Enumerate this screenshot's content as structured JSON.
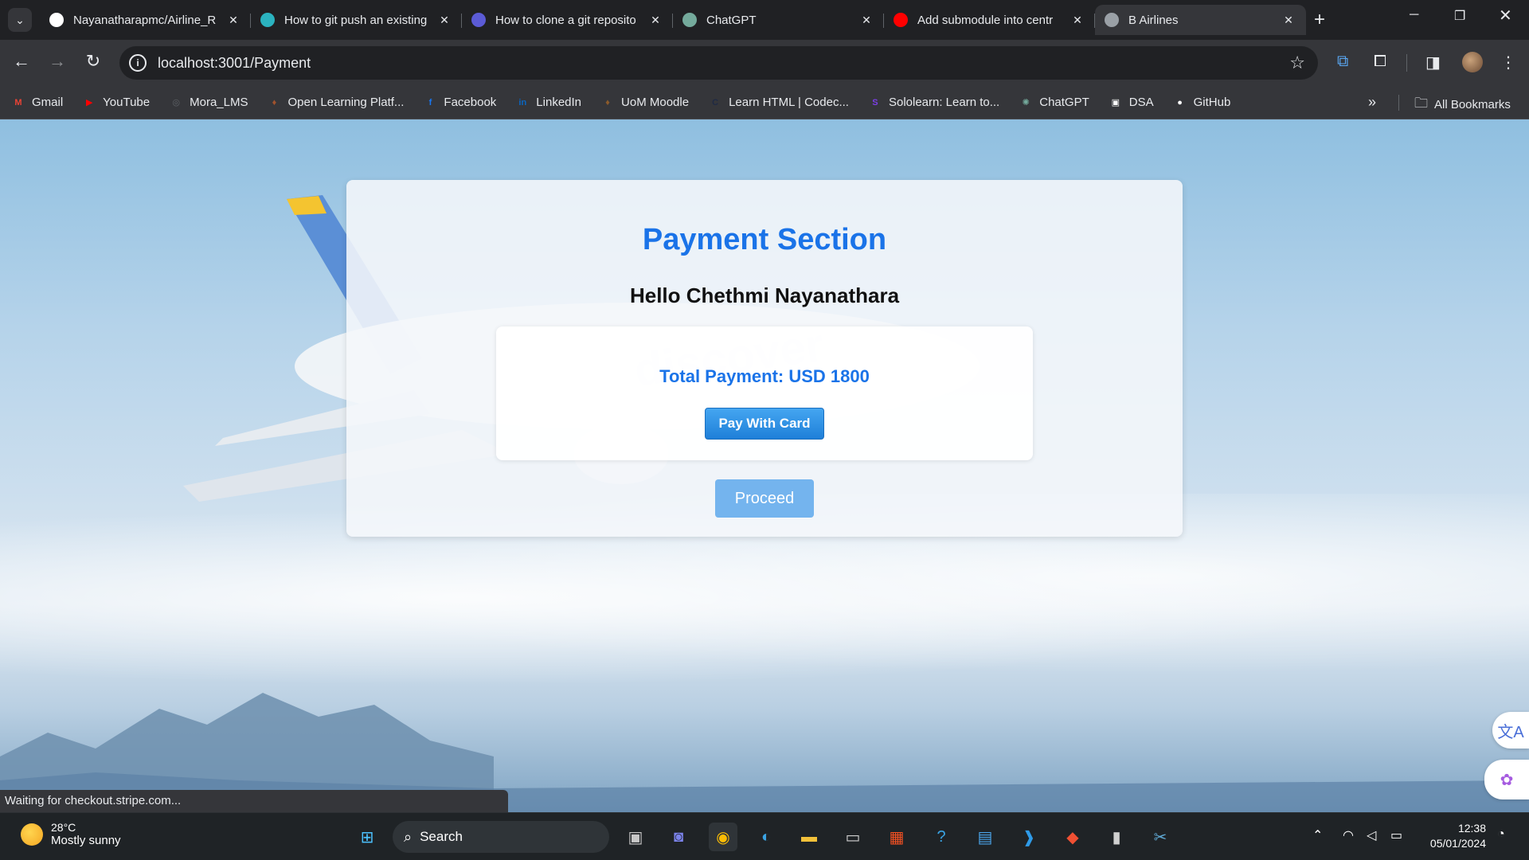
{
  "browser": {
    "tabs": [
      {
        "title": "Nayanatharapmc/Airline_R",
        "icon": "github-icon",
        "color": "#ffffff",
        "active": false
      },
      {
        "title": "How to git push an existing",
        "icon": "eye-icon",
        "color": "#2bb3c0",
        "active": false
      },
      {
        "title": "How to clone a git reposito",
        "icon": "terminal-icon",
        "color": "#5b5bd6",
        "active": false
      },
      {
        "title": "ChatGPT",
        "icon": "chatgpt-icon",
        "color": "#74aa9c",
        "active": false
      },
      {
        "title": "Add submodule into centr",
        "icon": "youtube-icon",
        "color": "#ff0000",
        "active": false
      },
      {
        "title": "B Airlines",
        "icon": "globe-icon",
        "color": "#9aa0a6",
        "active": true
      }
    ],
    "url": "localhost:3001/Payment",
    "bookmarks": [
      {
        "label": "Gmail",
        "icon": "gmail-icon",
        "color": "#ea4335",
        "glyph": "M"
      },
      {
        "label": "YouTube",
        "icon": "youtube-icon",
        "color": "#ff0000",
        "glyph": "▶"
      },
      {
        "label": "Mora_LMS",
        "icon": "globe-icon",
        "color": "#5f6368",
        "glyph": "◎"
      },
      {
        "label": "Open Learning Platf...",
        "icon": "open-learning-icon",
        "color": "#a0522d",
        "glyph": "♦"
      },
      {
        "label": "Facebook",
        "icon": "facebook-icon",
        "color": "#1877f2",
        "glyph": "f"
      },
      {
        "label": "LinkedIn",
        "icon": "linkedin-icon",
        "color": "#0a66c2",
        "glyph": "in"
      },
      {
        "label": "UoM Moodle",
        "icon": "moodle-icon",
        "color": "#8b5a2b",
        "glyph": "♦"
      },
      {
        "label": "Learn HTML | Codec...",
        "icon": "codecademy-icon",
        "color": "#1f2a44",
        "glyph": "C"
      },
      {
        "label": "Sololearn: Learn to...",
        "icon": "sololearn-icon",
        "color": "#7b3fe4",
        "glyph": "S"
      },
      {
        "label": "ChatGPT",
        "icon": "chatgpt-icon",
        "color": "#74aa9c",
        "glyph": "✺"
      },
      {
        "label": "DSA",
        "icon": "dsa-icon",
        "color": "#ffffff",
        "glyph": "▣"
      },
      {
        "label": "GitHub",
        "icon": "github-icon",
        "color": "#ffffff",
        "glyph": "●"
      }
    ],
    "all_bookmarks": "All Bookmarks",
    "status": "Waiting for checkout.stripe.com..."
  },
  "page": {
    "title": "Payment Section",
    "greeting": "Hello Chethmi Nayanathara",
    "total": "Total Payment: USD 1800",
    "pay_button": "Pay With Card",
    "proceed_button": "Proceed",
    "accent": "#1a73e8"
  },
  "taskbar": {
    "temperature": "28°C",
    "weather": "Mostly sunny",
    "search": "Search",
    "time": "12:38",
    "date": "05/01/2024"
  }
}
